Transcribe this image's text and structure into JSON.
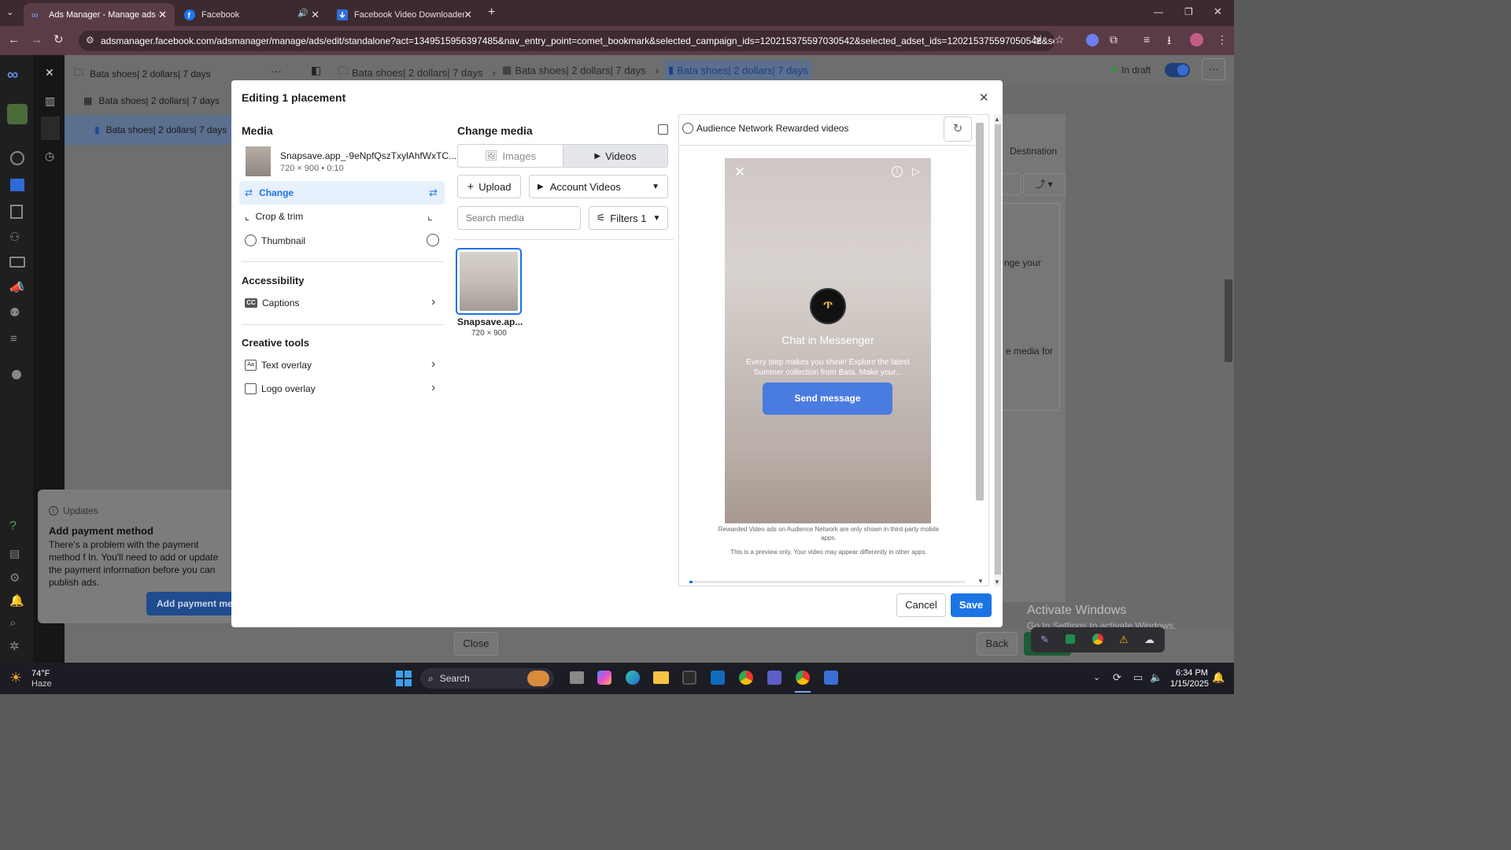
{
  "browser": {
    "tabs": [
      {
        "title": "Ads Manager - Manage ads - A",
        "active": true
      },
      {
        "title": "Facebook",
        "active": false
      },
      {
        "title": "Facebook Video Downloader - I",
        "active": false
      }
    ],
    "url": "adsmanager.facebook.com/adsmanager/manage/ads/edit/standalone?act=1349515956397485&nav_entry_point=comet_bookmark&selected_campaign_ids=120215375597030542&selected_adset_ids=120215375597050542&select..."
  },
  "background": {
    "tree": [
      "Bata shoes| 2 dollars| 7 days",
      "Bata shoes| 2 dollars| 7 days",
      "Bata shoes| 2 dollars| 7 days"
    ],
    "breadcrumb": [
      "Bata shoes| 2 dollars| 7 days",
      "Bata shoes| 2 dollars| 7 days",
      "Bata shoes| 2 dollars| 7 days"
    ],
    "status": "In draft",
    "destination_tab": "Destination",
    "partial_text_1": "nge your",
    "partial_text_2": "e media for",
    "updates_header": "Updates",
    "updates_title": "Add payment method",
    "updates_body": "There's a problem with the payment method f In. You'll need to add or update the payment information before you can publish ads.",
    "updates_button": "Add payment met",
    "close_button": "Close",
    "back_button": "Back",
    "watermark_title": "Activate Windows",
    "watermark_sub": "Go to Settings to activate Windows."
  },
  "modal": {
    "title": "Editing 1 placement",
    "media_heading": "Media",
    "file_name": "Snapsave.app_-9eNpfQszTxylAhfWxTC...",
    "file_meta": "720 × 900 • 0:10",
    "actions": [
      "Change",
      "Crop & trim",
      "Thumbnail"
    ],
    "accessibility_heading": "Accessibility",
    "captions": "Captions",
    "creative_heading": "Creative tools",
    "text_overlay": "Text overlay",
    "logo_overlay": "Logo overlay",
    "change_media_heading": "Change media",
    "tab_images": "Images",
    "tab_videos": "Videos",
    "upload": "Upload",
    "account_videos": "Account Videos",
    "search_placeholder": "Search media",
    "filters": "Filters 1",
    "thumb_name": "Snapsave.ap...",
    "thumb_size": "720 × 900",
    "preview_label": "Audience Network Rewarded videos",
    "chat_title": "Chat in Messenger",
    "chat_body": "Every step makes you shine! Explore the latest Summer collection from Bata. Make your...",
    "send_button": "Send message",
    "note1": "Rewarded Video ads on Audience Network are only shown in third-party mobile apps.",
    "note2": "This is a preview only. Your video may appear differently in other apps.",
    "cancel": "Cancel",
    "save": "Save"
  },
  "taskbar": {
    "temp": "74°F",
    "weather": "Haze",
    "search": "Search",
    "time": "6:34 PM",
    "date": "1/15/2025"
  },
  "colors": {
    "accent": "#1877f2",
    "save": "#1b74e4",
    "send": "#4a7be0"
  }
}
